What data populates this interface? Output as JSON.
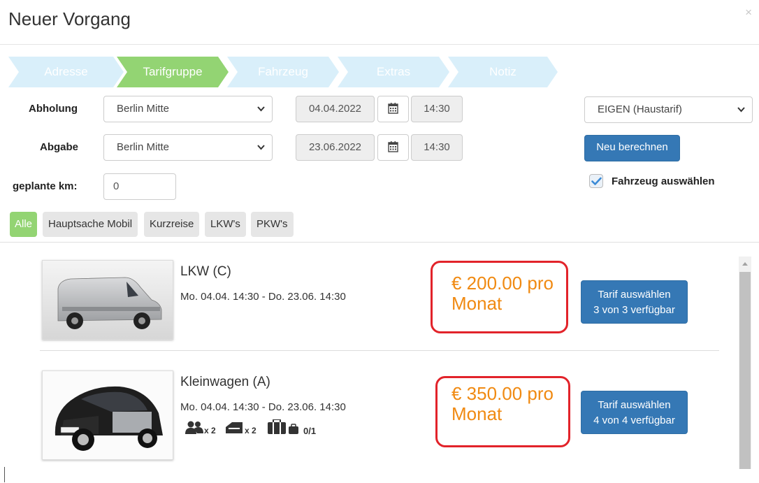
{
  "modal": {
    "title": "Neuer Vorgang",
    "close": "×"
  },
  "wizard": {
    "steps": [
      {
        "label": "Adresse",
        "state": "done"
      },
      {
        "label": "Tarifgruppe",
        "state": "active"
      },
      {
        "label": "Fahrzeug",
        "state": "done"
      },
      {
        "label": "Extras",
        "state": "done"
      },
      {
        "label": "Notiz",
        "state": "done"
      }
    ]
  },
  "form": {
    "pickup": {
      "label": "Abholung",
      "location": "Berlin Mitte",
      "date": "04.04.2022",
      "time": "14:30"
    },
    "dropoff": {
      "label": "Abgabe",
      "location": "Berlin Mitte",
      "date": "23.06.2022",
      "time": "14:30"
    },
    "km": {
      "label": "geplante km:",
      "value": "0"
    },
    "tariff": "EIGEN (Haustarif)",
    "recalculate": "Neu berechnen",
    "choose_vehicle": {
      "label": "Fahrzeug auswählen",
      "checked": true
    }
  },
  "filters": [
    {
      "label": "Alle",
      "active": true
    },
    {
      "label": "Hauptsache Mobil",
      "active": false
    },
    {
      "label": "Kurzreise",
      "active": false
    },
    {
      "label": "LKW's",
      "active": false
    },
    {
      "label": "PKW's",
      "active": false
    }
  ],
  "vehicles": [
    {
      "name": "LKW (C)",
      "dates": "Mo. 04.04. 14:30 - Do. 23.06. 14:30",
      "price_line1": "€ 200.00 pro",
      "price_line2": "Monat",
      "button_line1": "Tarif auswählen",
      "button_line2": "3 von 3 verfügbar"
    },
    {
      "name": "Kleinwagen (A)",
      "dates": "Mo. 04.04. 14:30 - Do. 23.06. 14:30",
      "price_line1": "€ 350.00 pro",
      "price_line2": "Monat",
      "button_line1": "Tarif auswählen",
      "button_line2": "4 von 4 verfügbar",
      "features": {
        "persons": "x 2",
        "doors": "x 2",
        "luggage": "0/1"
      }
    }
  ],
  "colors": {
    "accent_green": "#93d473",
    "step_light": "#d9effa",
    "primary": "#3578b5",
    "price": "#f08a12",
    "highlight": "#e2232a"
  }
}
